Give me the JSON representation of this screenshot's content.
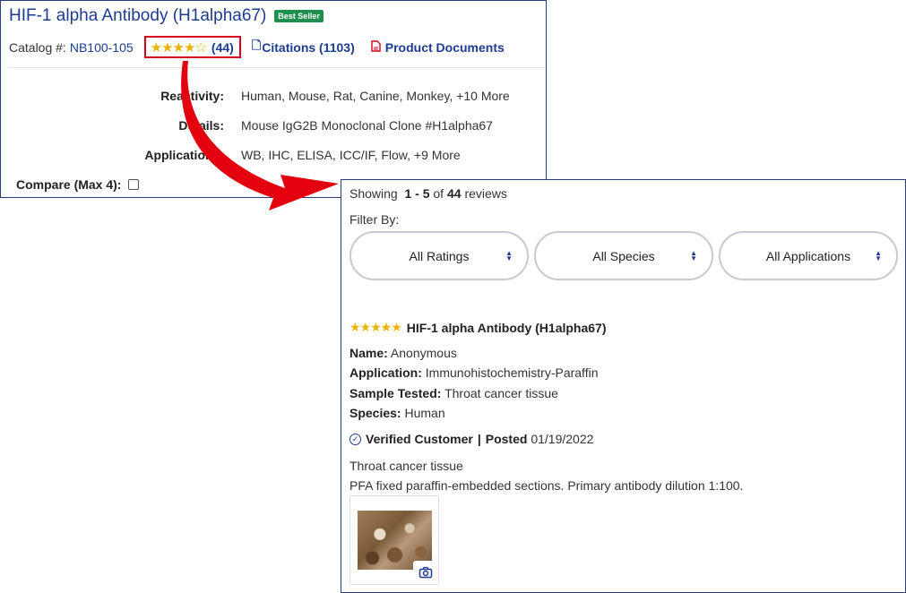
{
  "product": {
    "title": "HIF-1 alpha Antibody (H1alpha67)",
    "badge": "Best Seller",
    "catalog_label": "Catalog #:",
    "catalog_number": "NB100-105",
    "rating_stars": "★★★★☆",
    "rating_count": "(44)",
    "citations_label": "Citations (1103)",
    "documents_label": "Product Documents",
    "specs": [
      {
        "label": "Reactivity:",
        "value": "Human, Mouse, Rat, Canine, Monkey, +10 More"
      },
      {
        "label": "Details:",
        "value": "Mouse IgG2B Monoclonal Clone #H1alpha67"
      },
      {
        "label": "Applications:",
        "value": "WB, IHC, ELISA, ICC/IF, Flow, +9 More"
      }
    ],
    "compare_label": "Compare (Max 4):"
  },
  "reviews": {
    "showing_prefix": "Showing",
    "range": "1 - 5",
    "of": "of",
    "total": "44",
    "suffix": "reviews",
    "filter_by": "Filter By:",
    "filters": [
      "All Ratings",
      "All Species",
      "All Applications"
    ],
    "item": {
      "stars": "★★★★★",
      "title": "HIF-1 alpha Antibody (H1alpha67)",
      "name_label": "Name:",
      "name_value": "Anonymous",
      "application_label": "Application:",
      "application_value": "Immunohistochemistry-Paraffin",
      "sample_label": "Sample Tested:",
      "sample_value": "Throat cancer tissue",
      "species_label": "Species:",
      "species_value": "Human",
      "verified_label": "Verified Customer",
      "posted_label": "Posted",
      "posted_date": "01/19/2022",
      "headline": "Throat cancer tissue",
      "body": "PFA fixed paraffin-embedded sections. Primary antibody dilution 1:100."
    }
  },
  "colors": {
    "link_blue": "#1d3c8f",
    "highlight_red": "#d6001c",
    "star_gold": "#e8b400",
    "badge_green": "#1e8f4e"
  },
  "icons": [
    "citations-icon",
    "pdf-icon",
    "checkbox-icon",
    "caret-icon",
    "verified-check-icon",
    "camera-icon",
    "arrow-annotation"
  ]
}
